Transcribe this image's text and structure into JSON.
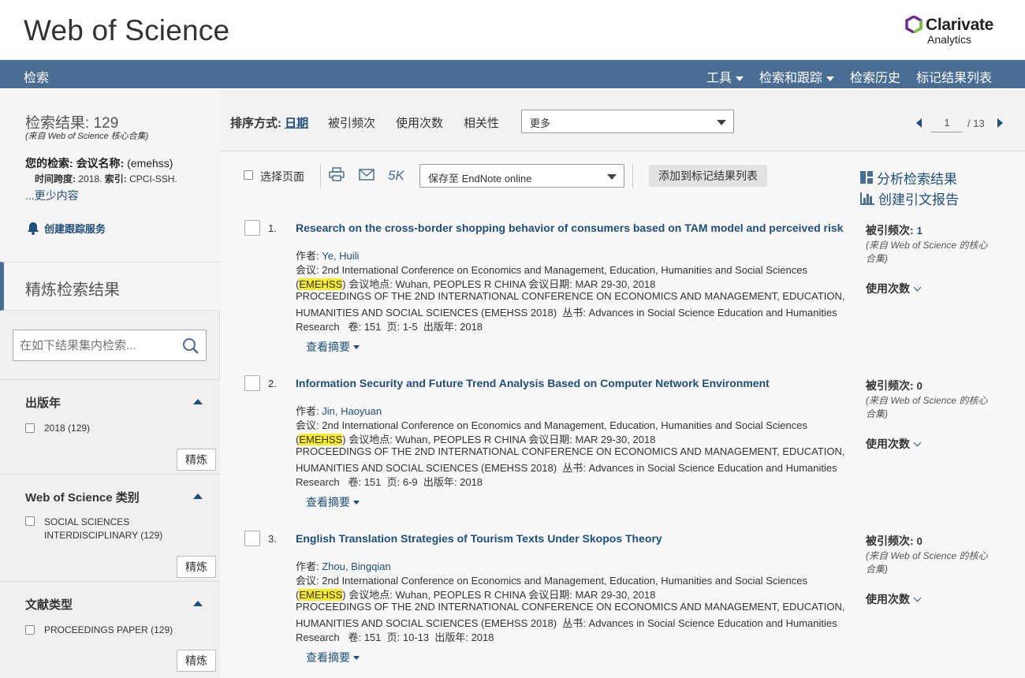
{
  "header": {
    "brand": "Web of Science",
    "clarivate_name": "Clarivate",
    "clarivate_sub": "Analytics"
  },
  "nav": {
    "search": "检索",
    "tools": "工具",
    "search_track": "检索和跟踪",
    "history": "检索历史",
    "marked": "标记结果列表"
  },
  "sidebar": {
    "results_count": "检索结果: 129",
    "results_source": "(来自 Web of Science 核心合集)",
    "your_query_label": "您的检索:",
    "conf_label": "会议名称:",
    "conf_value": "(emehss)",
    "timespan_label": "时间跨度:",
    "timespan_value": "2018.",
    "index_label": "索引:",
    "index_value": "CPCI-SSH.",
    "less_link": "...更少内容",
    "create_alert": "创建跟踪服务",
    "refine_title": "精炼检索结果",
    "search_within_placeholder": "在如下结果集内检索...",
    "refine_btn": "精炼",
    "facets": [
      {
        "title": "出版年",
        "option": "2018 (129)"
      },
      {
        "title": "Web of Science 类别",
        "option_line1": "SOCIAL SCIENCES",
        "option_line2": "INTERDISCIPLINARY (129)"
      },
      {
        "title": "文献类型",
        "option": "PROCEEDINGS PAPER (129)"
      }
    ]
  },
  "sortbar": {
    "label": "排序方式:",
    "date": "日期",
    "times_cited": "被引频次",
    "usage_count": "使用次数",
    "relevance": "相关性",
    "more": "更多",
    "page_current": "1",
    "page_total": "/ 13"
  },
  "toolbar": {
    "select_page": "选择页面",
    "five_k": "5K",
    "save_to": "保存至 EndNote online",
    "add_marked": "添加到标记结果列表",
    "analyze": "分析检索结果",
    "citation_report": "创建引文报告"
  },
  "record_labels": {
    "author_prefix": "作者: ",
    "conf_prefix": "会议: ",
    "conf_name": "2nd International Conference on Economics and Management, Education, Humanities and Social Sciences",
    "conf_abbr_open": "(",
    "conf_abbr": "EMEHSS",
    "conf_abbr_close": ")",
    "location_label": " 会议地点: ",
    "location": "Wuhan, PEOPLES R CHINA",
    "date_label": " 会议日期: ",
    "date": "MAR 29-30, 2018",
    "proc_line1": "PROCEEDINGS OF THE 2ND INTERNATIONAL CONFERENCE ON ECONOMICS AND MANAGEMENT, EDUCATION,",
    "proc_line2": "HUMANITIES AND SOCIAL SCIENCES (EMEHSS 2018)  丛书: Advances in Social Science Education and Humanities",
    "research": "Research",
    "volume_label": "   卷: ",
    "volume": "151",
    "pages_label": "  页: ",
    "year_label": "  出版年: ",
    "year": "2018",
    "view_abstract": "查看摘要",
    "cited_label": "被引频次: ",
    "cited_src": "(来自 Web of Science 的核心合集)",
    "usage": "使用次数"
  },
  "records": [
    {
      "num": "1.",
      "title": "Research on the cross-border shopping behavior of consumers based on TAM model and perceived risk",
      "author": "Ye, Huili",
      "pages": "1-5",
      "cited": "1"
    },
    {
      "num": "2.",
      "title": "Information Security and Future Trend Analysis Based on Computer Network Environment",
      "author": "Jin, Haoyuan",
      "pages": "6-9",
      "cited": "0"
    },
    {
      "num": "3.",
      "title": "English Translation Strategies of Tourism Texts Under Skopos Theory",
      "author": "Zhou, Bingqian",
      "pages": "10-13",
      "cited": "0"
    }
  ],
  "colors": {
    "nav_bg": "#4a6d93",
    "link": "#1f4e79",
    "highlight": "#f7ec2c",
    "clarivate_purple": "#6c2c91",
    "clarivate_green": "#7ac143"
  }
}
